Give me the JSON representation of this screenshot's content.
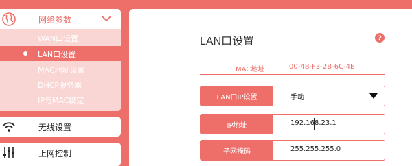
{
  "sidebar": {
    "groups": [
      {
        "label": "网络参数",
        "icon": "globe-icon",
        "expanded": true,
        "items": [
          {
            "label": "WAN口设置",
            "active": false
          },
          {
            "label": "LAN口设置",
            "active": true
          },
          {
            "label": "MAC地址设置",
            "active": false
          },
          {
            "label": "DHCP服务器",
            "active": false
          },
          {
            "label": "IP与MAC绑定",
            "active": false
          }
        ]
      },
      {
        "label": "无线设置",
        "icon": "wifi-icon"
      },
      {
        "label": "上网控制",
        "icon": "sliders-icon"
      }
    ]
  },
  "main": {
    "title": "LAN口设置",
    "help_icon": "help-icon",
    "mac": {
      "label": "MAC地址",
      "value": "00-4B-F3-2B-6C-4E"
    },
    "fields": [
      {
        "label": "LAN口IP设置",
        "value": "手动",
        "type": "select"
      },
      {
        "label": "IP地址",
        "value": "192.168.23.1",
        "type": "text",
        "focused": true
      },
      {
        "label": "子网掩码",
        "value": "255.255.255.0",
        "type": "text"
      }
    ]
  },
  "colors": {
    "accent": "#ee6f6a",
    "submenu_bg": "#f9d6d3",
    "panel_bg": "#ffffff"
  }
}
